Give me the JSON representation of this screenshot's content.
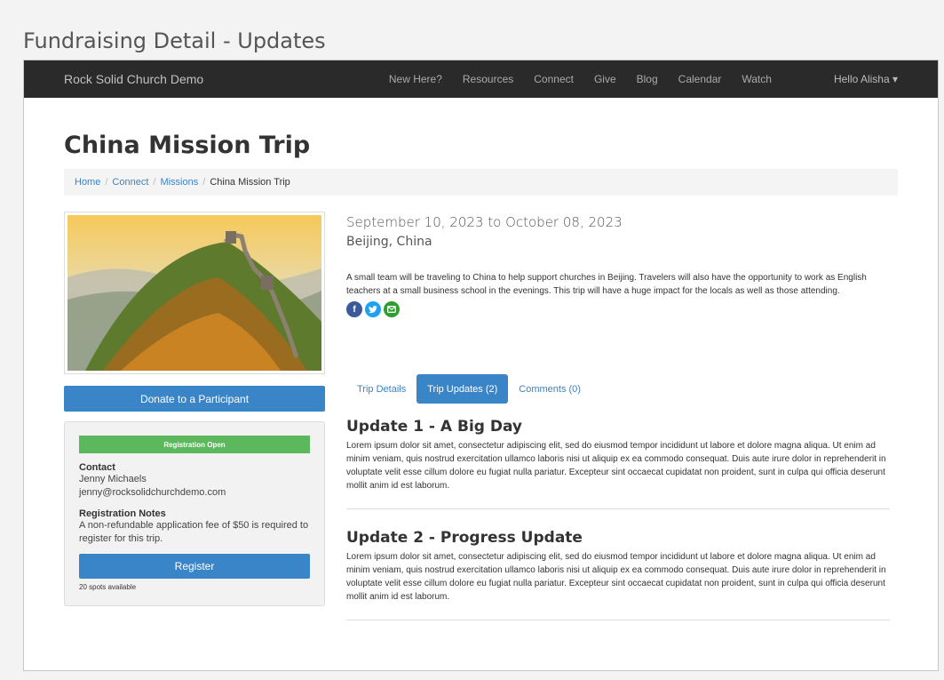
{
  "window": {
    "title": "Fundraising Detail - Updates"
  },
  "navbar": {
    "brand": "Rock Solid Church Demo",
    "links": [
      "New Here?",
      "Resources",
      "Connect",
      "Give",
      "Blog",
      "Calendar",
      "Watch"
    ],
    "user": "Hello Alisha ▾"
  },
  "page": {
    "title": "China Mission Trip"
  },
  "breadcrumb": {
    "items": [
      "Home",
      "Connect",
      "Missions"
    ],
    "current": "China Mission Trip"
  },
  "sidebar": {
    "donate_label": "Donate to a Participant",
    "status_badge": "Registration Open",
    "contact_heading": "Contact",
    "contact_name": "Jenny Michaels",
    "contact_email": "jenny@rocksolidchurchdemo.com",
    "notes_heading": "Registration Notes",
    "notes_text": "A non-refundable application fee of $50 is required to register for this trip.",
    "register_label": "Register",
    "spots": "20 spots available"
  },
  "trip": {
    "dates": "September 10, 2023 to October 08, 2023",
    "location": "Beijing, China",
    "description": "A small team will be traveling to China to help support churches in Beijing. Travelers will also have the opportunity to work as English teachers at a small business school in the evenings. This trip will have a huge impact for the locals as well as those attending.",
    "social": {
      "facebook_color": "#3b5998",
      "twitter_color": "#1da1f2",
      "email_color": "#2e9e2e"
    }
  },
  "tabs": [
    {
      "label": "Trip Details"
    },
    {
      "label": "Trip Updates (2)"
    },
    {
      "label": "Comments (0)"
    }
  ],
  "updates": [
    {
      "title": "Update 1 - A Big Day",
      "body": "Lorem ipsum dolor sit amet, consectetur adipiscing elit, sed do eiusmod tempor incididunt ut labore et dolore magna aliqua. Ut enim ad minim veniam, quis nostrud exercitation ullamco laboris nisi ut aliquip ex ea commodo consequat. Duis aute irure dolor in reprehenderit in voluptate velit esse cillum dolore eu fugiat nulla pariatur. Excepteur sint occaecat cupidatat non proident, sunt in culpa qui officia deserunt mollit anim id est laborum."
    },
    {
      "title": "Update 2 - Progress Update",
      "body": "Lorem ipsum dolor sit amet, consectetur adipiscing elit, sed do eiusmod tempor incididunt ut labore et dolore magna aliqua. Ut enim ad minim veniam, quis nostrud exercitation ullamco laboris nisi ut aliquip ex ea commodo consequat. Duis aute irure dolor in reprehenderit in voluptate velit esse cillum dolore eu fugiat nulla pariatur. Excepteur sint occaecat cupidatat non proident, sunt in culpa qui officia deserunt mollit anim id est laborum."
    }
  ]
}
